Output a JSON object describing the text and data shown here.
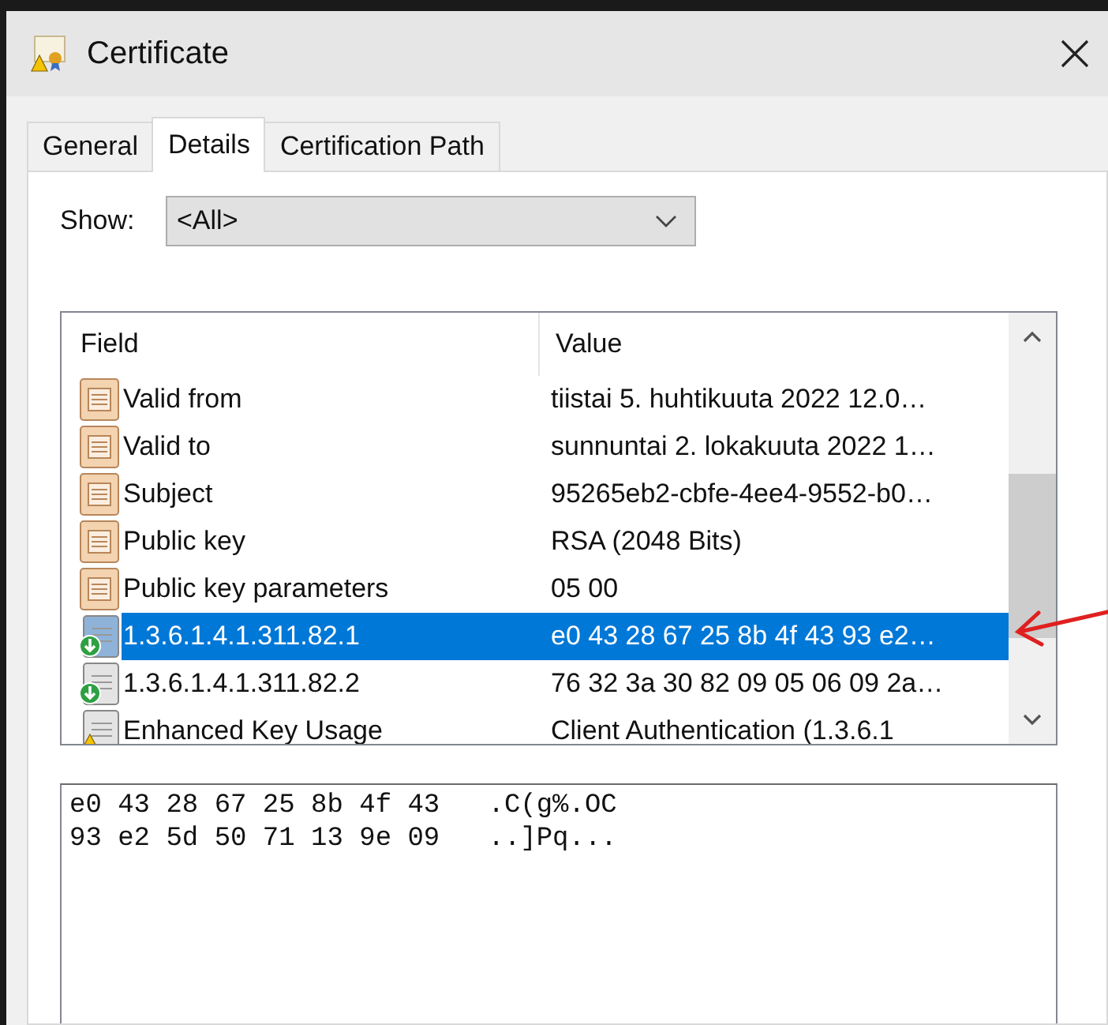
{
  "window": {
    "title": "Certificate"
  },
  "tabs": [
    {
      "label": "General",
      "selected": false
    },
    {
      "label": "Details",
      "selected": true
    },
    {
      "label": "Certification Path",
      "selected": false
    }
  ],
  "show": {
    "label": "Show:",
    "value": "<All>"
  },
  "table": {
    "columns": [
      "Field",
      "Value"
    ],
    "rows": [
      {
        "kind": "property",
        "field": "Valid from",
        "value": "tiistai 5. huhtikuuta 2022 12.0…",
        "selected": false
      },
      {
        "kind": "property",
        "field": "Valid to",
        "value": "sunnuntai 2. lokakuuta 2022 1…",
        "selected": false
      },
      {
        "kind": "property",
        "field": "Subject",
        "value": "95265eb2-cbfe-4ee4-9552-b0…",
        "selected": false
      },
      {
        "kind": "property",
        "field": "Public key",
        "value": "RSA (2048 Bits)",
        "selected": false
      },
      {
        "kind": "property",
        "field": "Public key parameters",
        "value": "05 00",
        "selected": false
      },
      {
        "kind": "extension",
        "field": "1.3.6.1.4.1.311.82.1",
        "value": "e0 43 28 67 25 8b 4f 43 93 e2…",
        "selected": true
      },
      {
        "kind": "extension",
        "field": "1.3.6.1.4.1.311.82.2",
        "value": "76 32 3a 30 82 09 05 06 09 2a…",
        "selected": false
      },
      {
        "kind": "critical-extension",
        "field": "Enhanced Key Usage",
        "value": "Client Authentication (1.3.6.1",
        "selected": false
      }
    ]
  },
  "detail": {
    "lines": [
      "e0 43 28 67 25 8b 4f 43   .C(g%.OC",
      "93 e2 5d 50 71 13 9e 09   ..]Pq..."
    ]
  }
}
